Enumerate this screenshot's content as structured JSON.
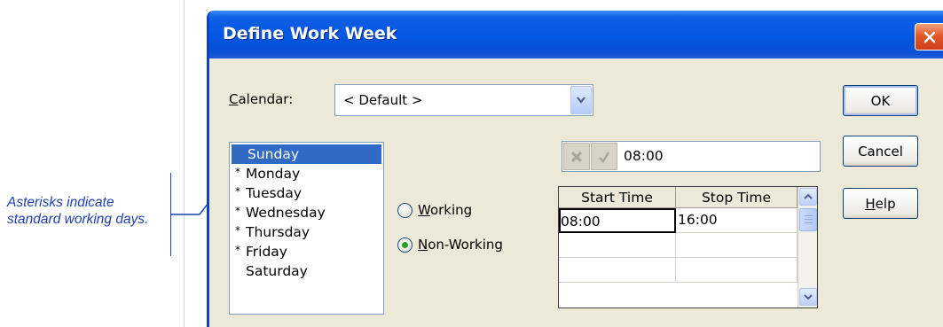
{
  "annotation": {
    "text": "Asterisks indicate standard working days."
  },
  "dialog": {
    "title": "Define Work Week",
    "calendar_label": "Calendar:",
    "calendar_value": "< Default >",
    "buttons": {
      "ok": "OK",
      "cancel": "Cancel",
      "help": "Help"
    },
    "days": [
      {
        "label": "Sunday",
        "asterisk": "",
        "selected": true
      },
      {
        "label": "Monday",
        "asterisk": "*",
        "selected": false
      },
      {
        "label": "Tuesday",
        "asterisk": "*",
        "selected": false
      },
      {
        "label": "Wednesday",
        "asterisk": "*",
        "selected": false
      },
      {
        "label": "Thursday",
        "asterisk": "*",
        "selected": false
      },
      {
        "label": "Friday",
        "asterisk": "*",
        "selected": false
      },
      {
        "label": "Saturday",
        "asterisk": "",
        "selected": false
      }
    ],
    "radio_working": "Working",
    "radio_nonworking": "Non-Working",
    "selected_radio": "Non-Working",
    "edit_value": "08:00",
    "grid": {
      "headers": [
        "Start Time",
        "Stop Time"
      ],
      "rows": [
        [
          "08:00",
          "16:00"
        ]
      ]
    }
  },
  "colors": {
    "annotation": "#1f3fb4",
    "titlebar": "#0457e0",
    "dialog_bg": "#ece9d8",
    "selection": "#316ac5"
  },
  "icons": [
    "close-icon",
    "dropdown-arrow-icon",
    "cancel-x-icon",
    "check-icon",
    "scroll-up-icon",
    "scroll-down-icon"
  ]
}
